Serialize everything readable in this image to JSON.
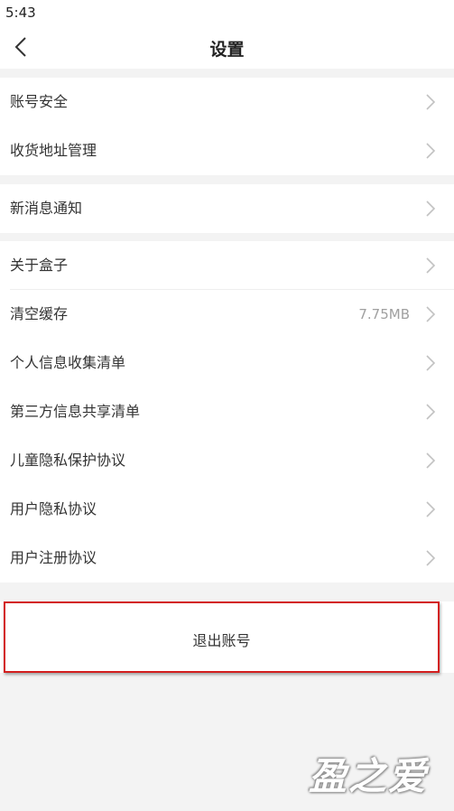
{
  "status_bar": {
    "time": "5:43"
  },
  "nav": {
    "title": "设置",
    "back_icon": "chevron-left-icon"
  },
  "groups": [
    {
      "items": [
        {
          "label": "账号安全",
          "value": ""
        },
        {
          "label": "收货地址管理",
          "value": ""
        }
      ]
    },
    {
      "items": [
        {
          "label": "新消息通知",
          "value": ""
        }
      ]
    },
    {
      "items": [
        {
          "label": "关于盒子",
          "value": ""
        },
        {
          "label": "清空缓存",
          "value": "7.75MB"
        },
        {
          "label": "个人信息收集清单",
          "value": ""
        },
        {
          "label": "第三方信息共享清单",
          "value": ""
        },
        {
          "label": "儿童隐私保护协议",
          "value": ""
        },
        {
          "label": "用户隐私协议",
          "value": ""
        },
        {
          "label": "用户注册协议",
          "value": ""
        }
      ]
    }
  ],
  "logout": {
    "label": "退出账号"
  },
  "watermark": {
    "text": "盈之爱"
  },
  "colors": {
    "background": "#f3f3f3",
    "surface": "#ffffff",
    "highlight_border": "#d31f1f",
    "text": "#333333",
    "muted": "#a0a0a0"
  }
}
